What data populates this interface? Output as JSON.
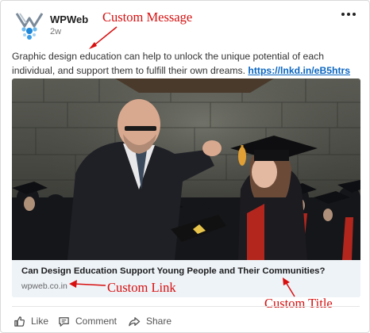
{
  "post": {
    "author": "WPWeb",
    "time_ago": "2w",
    "message": "Graphic design education can help to unlock the unique potential of each individual, and support them to fulfill their own dreams.",
    "message_link": "https://lnkd.in/eB5htrs"
  },
  "link_preview": {
    "title": "Can Design Education Support Young People and Their Communities?",
    "domain": "wpweb.co.in"
  },
  "actions": {
    "like": "Like",
    "comment": "Comment",
    "share": "Share"
  },
  "annotations": {
    "custom_message": "Custom Message",
    "custom_link": "Custom Link",
    "custom_title": "Custom Title"
  },
  "colors": {
    "annotation": "#d80f0f",
    "link": "#0a66c2",
    "preview_background": "#eef3f8"
  },
  "icons": {
    "more": "more-horizontal-icon",
    "like": "thumbs-up-icon",
    "comment": "comment-icon",
    "share": "share-arrow-icon"
  }
}
